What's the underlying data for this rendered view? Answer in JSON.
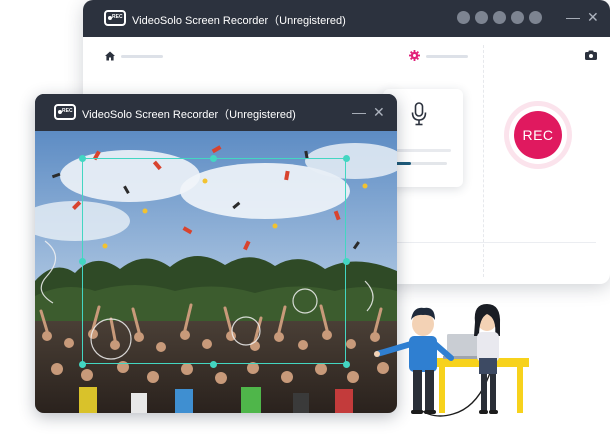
{
  "back_window": {
    "title": "VideoSolo Screen Recorder（Unregistered)",
    "logo_text": "REC",
    "window_buttons": [
      "circle-button",
      "circle-button",
      "circle-button",
      "circle-button",
      "circle-button"
    ],
    "minimize_glyph": "—",
    "close_glyph": "✕",
    "rec_button_label": "REC",
    "microphone_volume_percent": 30
  },
  "front_window": {
    "title": "VideoSolo Screen Recorder（Unregistered)",
    "logo_text": "REC",
    "minimize_glyph": "—",
    "close_glyph": "✕"
  },
  "icons": {
    "home": "home-icon",
    "settings": "gear-icon",
    "camera": "camera-icon",
    "microphone": "microphone-icon"
  },
  "colors": {
    "title_bar": "#2c323e",
    "rec_red": "#e0195f",
    "selection_teal": "#43d6c2",
    "accent_pink": "#e2207a",
    "slider_blue": "#1e5c7b",
    "desk_yellow": "#f7d21c"
  }
}
